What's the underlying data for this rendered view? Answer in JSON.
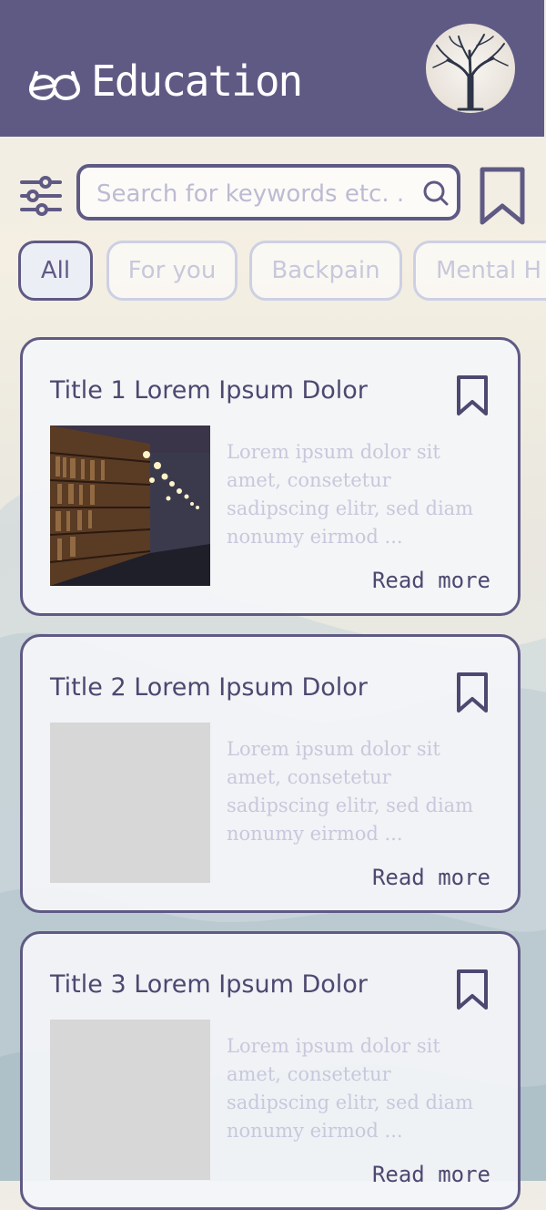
{
  "header": {
    "title": "Education",
    "logo_icon": "glasses-icon",
    "avatar_icon": "tree-avatar"
  },
  "search": {
    "placeholder": "Search for keywords etc. ...",
    "filter_icon": "sliders-icon",
    "search_icon": "search-icon",
    "bookmark_icon": "bookmark-icon"
  },
  "chips": [
    {
      "label": "All",
      "active": true
    },
    {
      "label": "For you",
      "active": false
    },
    {
      "label": "Backpain",
      "active": false
    },
    {
      "label": "Mental H",
      "active": false
    }
  ],
  "cards": [
    {
      "title": "Title 1 Lorem Ipsum Dolor",
      "text": "Lorem ipsum dolor sit amet, consetetur sadipscing elitr, sed diam nonumy eirmod ...",
      "read_more": "Read more",
      "image": "library-photo"
    },
    {
      "title": "Title 2 Lorem Ipsum Dolor",
      "text": "Lorem ipsum dolor sit amet, consetetur sadipscing elitr, sed diam nonumy eirmod ...",
      "read_more": "Read more",
      "image": "placeholder"
    },
    {
      "title": "Title 3 Lorem Ipsum Dolor",
      "text": "Lorem ipsum dolor sit amet, consetetur sadipscing elitr, sed diam nonumy eirmod ...",
      "read_more": "Read more",
      "image": "placeholder"
    }
  ],
  "colors": {
    "primary": "#5f5a84",
    "muted_text": "#c8c8dc",
    "placeholder_image": "#d7d7d7"
  }
}
